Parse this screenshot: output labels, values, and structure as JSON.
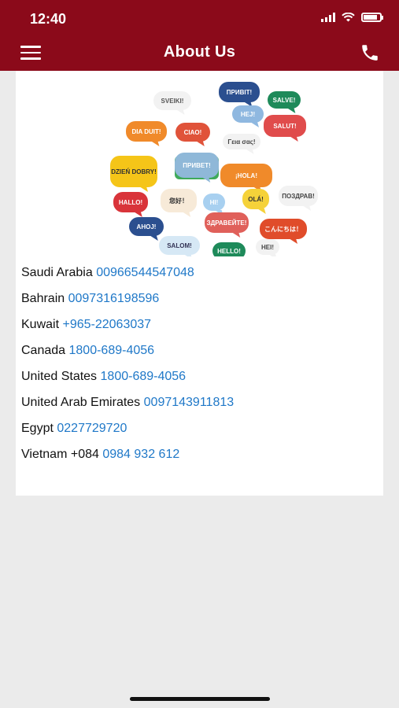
{
  "status_bar": {
    "time": "12:40",
    "battery_level": 0.85
  },
  "header": {
    "title": "About Us",
    "menu_icon": "hamburger-menu-icon",
    "call_icon": "phone-icon"
  },
  "language_bubbles": [
    {
      "text": "SVEIKI!",
      "color": "#f2f2f2",
      "text_color": "#555"
    },
    {
      "text": "ПРИВІТ!",
      "color": "#2b4f8f",
      "text_color": "#fff"
    },
    {
      "text": "SALVE!",
      "color": "#1e8a5a",
      "text_color": "#fff"
    },
    {
      "text": "HEJ!",
      "color": "#8fb8e0",
      "text_color": "#fff"
    },
    {
      "text": "DIA DUIT!",
      "color": "#f08a2a",
      "text_color": "#fff"
    },
    {
      "text": "CIAO!",
      "color": "#e0533a",
      "text_color": "#fff"
    },
    {
      "text": "SALUT!",
      "color": "#e04c4c",
      "text_color": "#fff"
    },
    {
      "text": "Γεια σας!",
      "color": "#f2f2f2",
      "text_color": "#444"
    },
    {
      "text": "DZIEŃ DOBRY!",
      "color": "#f5c518",
      "text_color": "#333"
    },
    {
      "text": "ПРИВЕТ!",
      "color": "#8fb8d8",
      "text_color": "#fff"
    },
    {
      "text": "¡HOLA!",
      "color": "#f08a2a",
      "text_color": "#fff"
    },
    {
      "text": "HALLO!",
      "color": "#d9343a",
      "text_color": "#fff"
    },
    {
      "text": "您好！",
      "color": "#f7ead8",
      "text_color": "#333"
    },
    {
      "text": "HI!",
      "color": "#a8d0f0",
      "text_color": "#fff"
    },
    {
      "text": "OLÁ!",
      "color": "#f5d23a",
      "text_color": "#333"
    },
    {
      "text": "ПОЗДРАВ!",
      "color": "#f2f2f2",
      "text_color": "#444"
    },
    {
      "text": "AHOJ!",
      "color": "#2b4f8f",
      "text_color": "#fff"
    },
    {
      "text": "ЗДРАВЕЙТЕ!",
      "color": "#e0605a",
      "text_color": "#fff"
    },
    {
      "text": "こんにちは！",
      "color": "#e04c2a",
      "text_color": "#fff"
    },
    {
      "text": "SALOM!",
      "color": "#d6e8f5",
      "text_color": "#335"
    },
    {
      "text": "HELLO!",
      "color": "#1e8a5a",
      "text_color": "#fff"
    },
    {
      "text": "HEI!",
      "color": "#f2f2f2",
      "text_color": "#444"
    }
  ],
  "contacts": [
    {
      "country": "Saudi Arabia",
      "prefix": "",
      "number": "00966544547048"
    },
    {
      "country": "Bahrain",
      "prefix": "",
      "number": "0097316198596"
    },
    {
      "country": "Kuwait",
      "prefix": "",
      "number": "+965-22063037"
    },
    {
      "country": "Canada",
      "prefix": "",
      "number": "1800-689-4056"
    },
    {
      "country": "United States",
      "prefix": "",
      "number": "1800-689-4056"
    },
    {
      "country": "United Arab Emirates",
      "prefix": "",
      "number": "0097143911813"
    },
    {
      "country": "Egypt",
      "prefix": "",
      "number": "0227729720"
    },
    {
      "country": "Vietnam",
      "prefix": "+084",
      "number": "0984 932 612"
    }
  ],
  "colors": {
    "header_bg": "#8b0a1a",
    "link": "#1f78c8",
    "page_bg": "#ebebeb"
  }
}
